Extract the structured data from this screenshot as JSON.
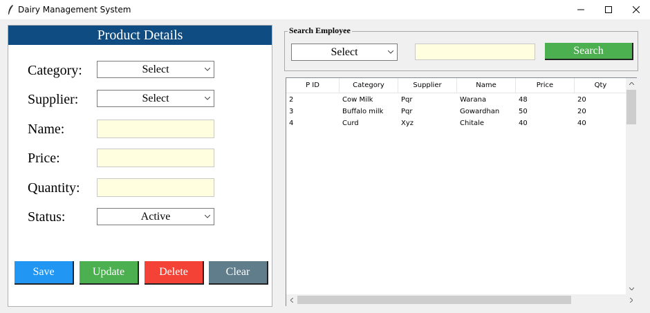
{
  "window": {
    "title": "Dairy Management System",
    "icon": "feather-icon"
  },
  "product_panel": {
    "header": "Product Details",
    "fields": {
      "category": {
        "label": "Category:",
        "value": "Select"
      },
      "supplier": {
        "label": "Supplier:",
        "value": "Select"
      },
      "name": {
        "label": "Name:",
        "value": ""
      },
      "price": {
        "label": "Price:",
        "value": ""
      },
      "quantity": {
        "label": "Quantity:",
        "value": ""
      },
      "status": {
        "label": "Status:",
        "value": "Active"
      }
    },
    "buttons": {
      "save": "Save",
      "update": "Update",
      "delete": "Delete",
      "clear": "Clear"
    },
    "colors": {
      "header_bg": "#0f4c81",
      "save": "#2196f3",
      "update": "#4caf50",
      "delete": "#f44336",
      "clear": "#607d8b",
      "input_bg": "#ffffe0"
    }
  },
  "search": {
    "legend": "Search Employee",
    "select_value": "Select",
    "input_value": "",
    "button": "Search",
    "button_color": "#4caf50"
  },
  "table": {
    "columns": [
      "P ID",
      "Category",
      "Supplier",
      "Name",
      "Price",
      "Qty"
    ],
    "rows": [
      [
        "2",
        "Cow Milk",
        "Pqr",
        "Warana",
        "48",
        "20"
      ],
      [
        "3",
        "Buffalo milk",
        "Pqr",
        "Gowardhan",
        "50",
        "20"
      ],
      [
        "4",
        "Curd",
        "Xyz",
        "Chitale",
        "40",
        "40"
      ]
    ]
  }
}
